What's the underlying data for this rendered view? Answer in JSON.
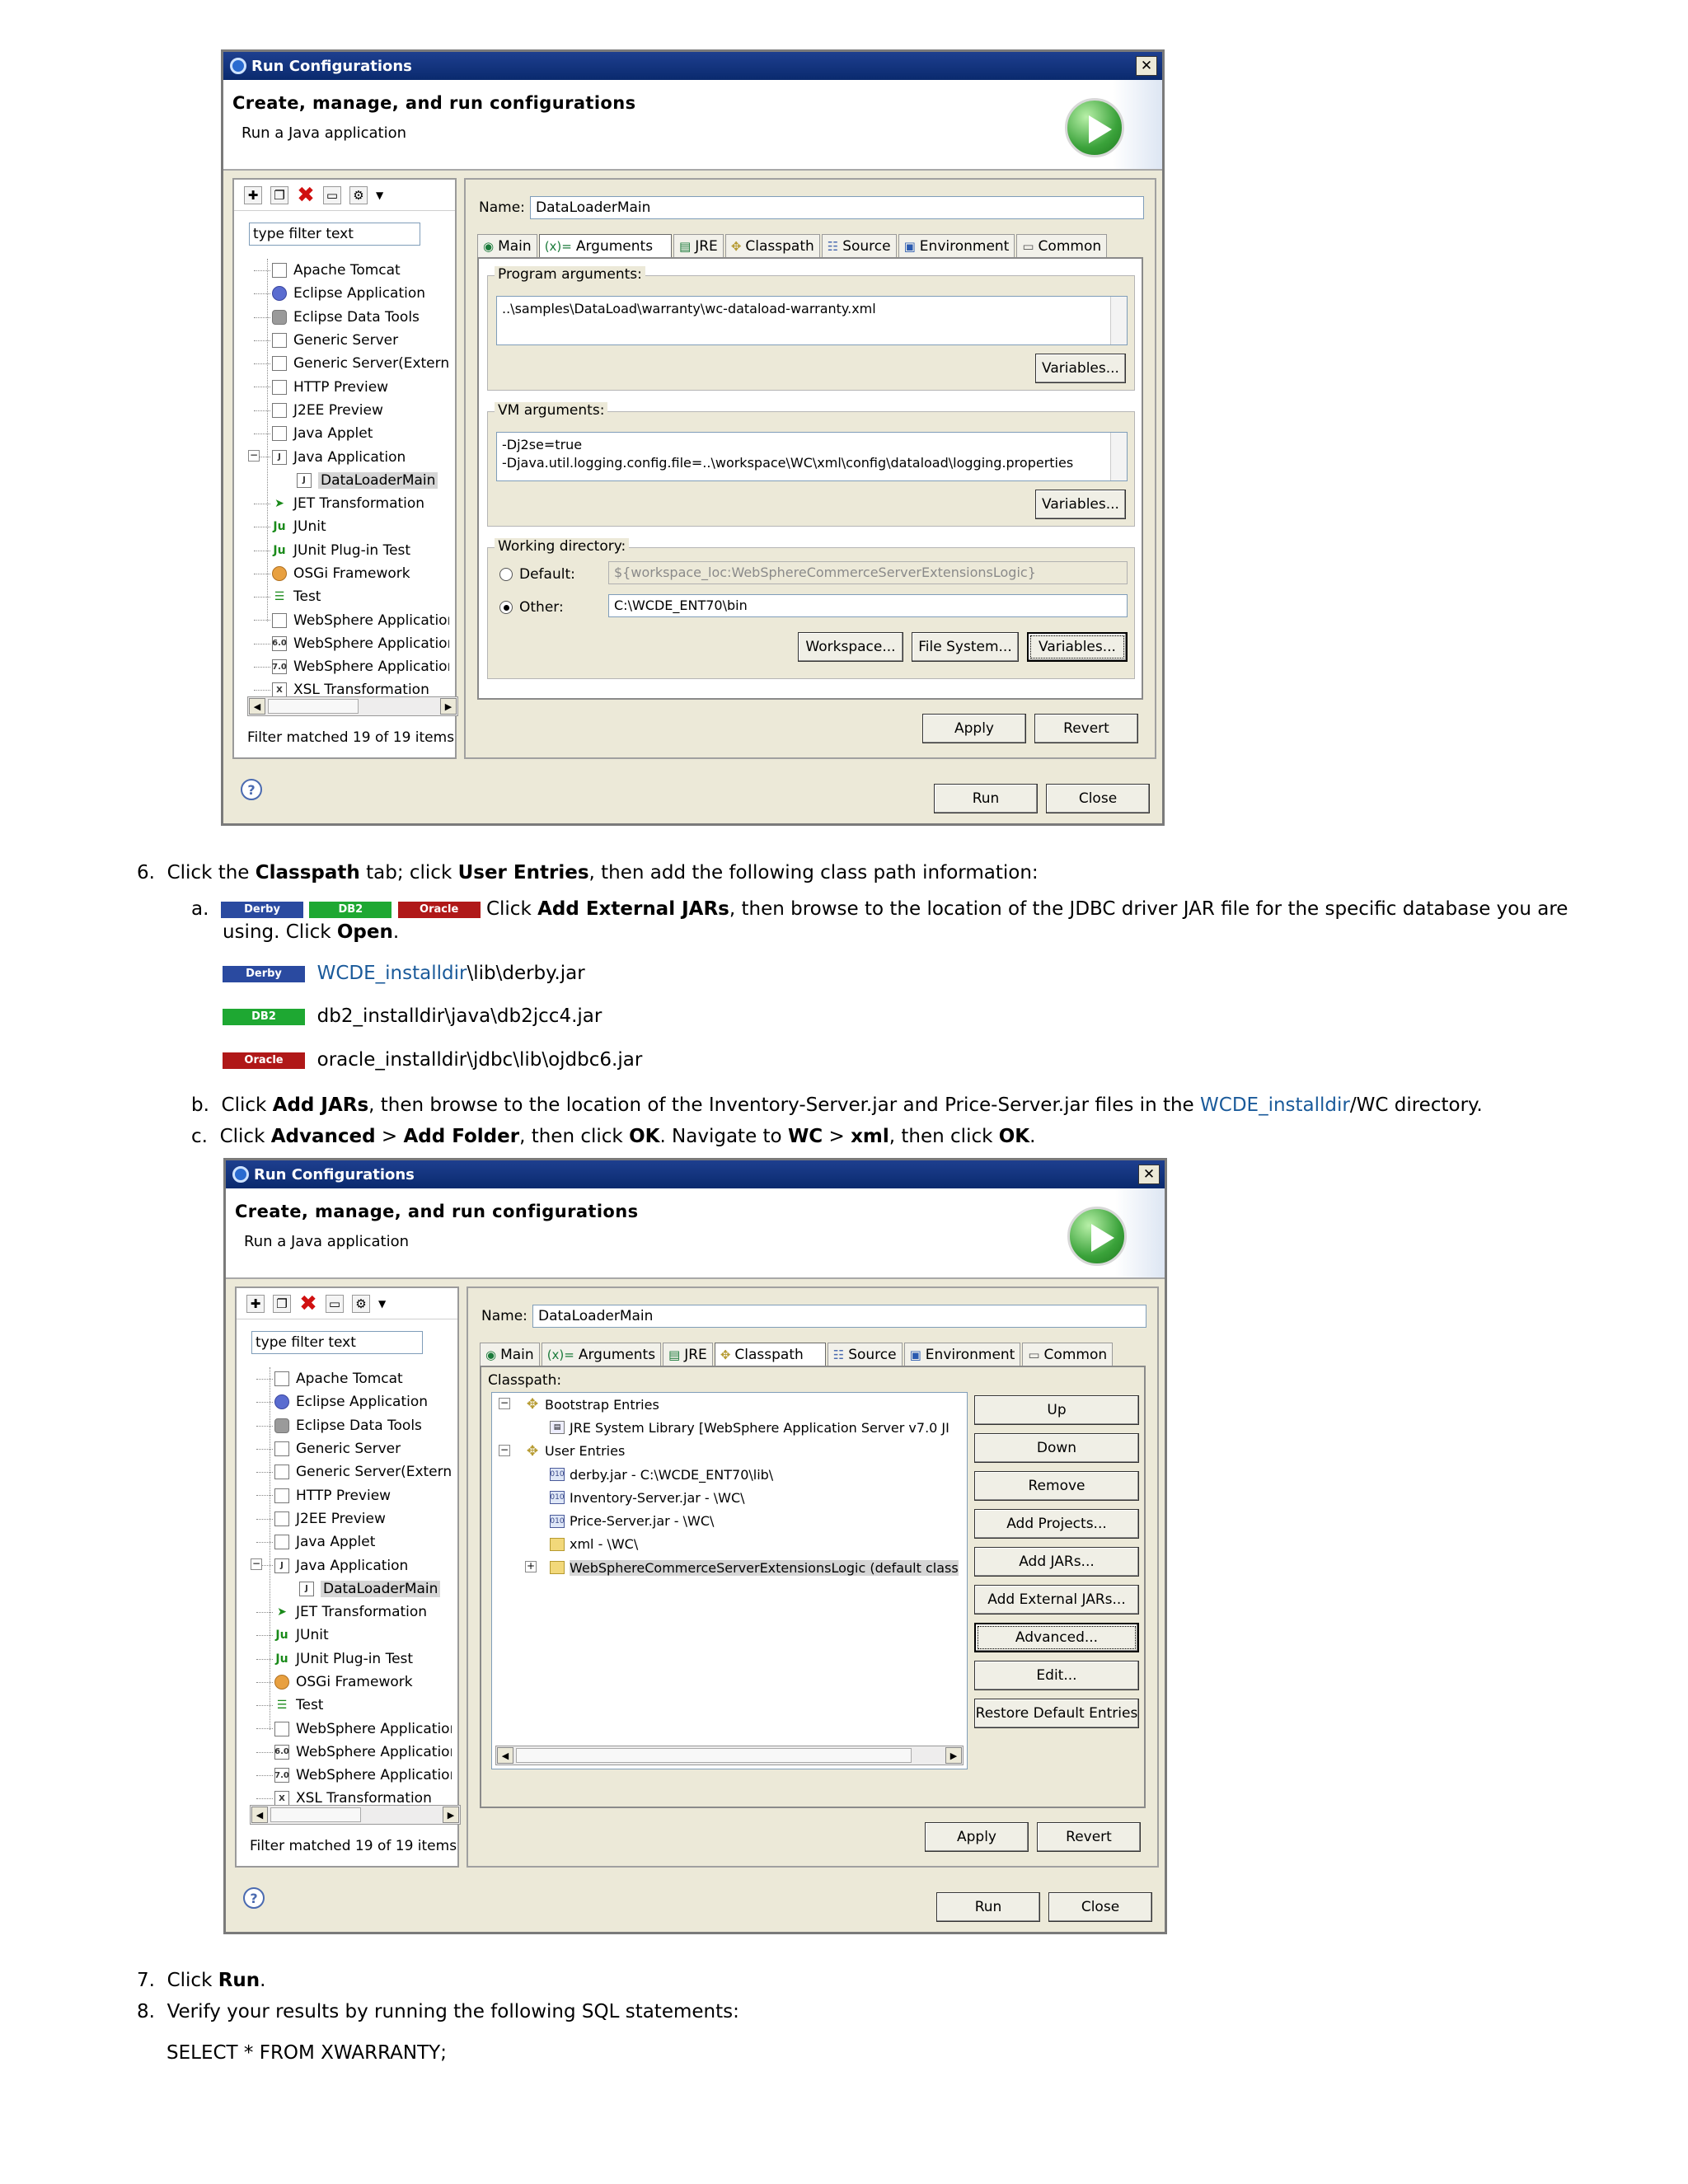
{
  "window1": {
    "title": "Run Configurations",
    "close_glyph": "✕",
    "banner_heading": "Create, manage, and run configurations",
    "banner_sub": "Run a Java application",
    "filter_text": "type filter text",
    "tree": [
      "Apache Tomcat",
      "Eclipse Application",
      "Eclipse Data Tools",
      "Generic Server",
      "Generic Server(Externa",
      "HTTP Preview",
      "J2EE Preview",
      "Java Applet",
      "Java Application",
      "DataLoaderMain",
      "JET Transformation",
      "JUnit",
      "JUnit Plug-in Test",
      "OSGi Framework",
      "Test",
      "WebSphere Application",
      "WebSphere Application",
      "WebSphere Application",
      "XSL Transformation"
    ],
    "filter_status": "Filter matched 19 of 19 items",
    "name_label": "Name:",
    "name_value": "DataLoaderMain",
    "tabs": [
      "Main",
      "Arguments",
      "JRE",
      "Classpath",
      "Source",
      "Environment",
      "Common"
    ],
    "program_args_label": "Program arguments:",
    "program_args": "..\\samples\\DataLoad\\warranty\\wc-dataload-warranty.xml",
    "vm_args_label": "VM arguments:",
    "vm_args": "-Dj2se=true\n-Djava.util.logging.config.file=..\\workspace\\WC\\xml\\config\\dataload\\logging.properties",
    "variables_label": "Variables...",
    "working_dir_label": "Working directory:",
    "default_label": "Default:",
    "default_value": "${workspace_loc:WebSphereCommerceServerExtensionsLogic}",
    "other_label": "Other:",
    "other_value": "C:\\WCDE_ENT70\\bin",
    "workspace_btn": "Workspace...",
    "filesystem_btn": "File System...",
    "apply": "Apply",
    "revert": "Revert",
    "run": "Run",
    "close": "Close",
    "help_glyph": "?"
  },
  "window2": {
    "title": "Run Configurations",
    "banner_heading": "Create, manage, and run configurations",
    "banner_sub": "Run a Java application",
    "classpath_label": "Classpath:",
    "classpath_items": [
      "Bootstrap Entries",
      "JRE System Library [WebSphere Application Server v7.0 JI",
      "User Entries",
      "derby.jar - C:\\WCDE_ENT70\\lib\\",
      "Inventory-Server.jar - \\WC\\",
      "Price-Server.jar - \\WC\\",
      "xml - \\WC\\",
      "WebSphereCommerceServerExtensionsLogic (default class"
    ],
    "buttons": [
      "Up",
      "Down",
      "Remove",
      "Add Projects...",
      "Add JARs...",
      "Add External JARs...",
      "Advanced...",
      "Edit...",
      "Restore Default Entries"
    ]
  },
  "doc": {
    "step6_num": "6.",
    "step6_a": "Click the ",
    "step6_b": "Classpath",
    "step6_c": " tab; click ",
    "step6_d": "User Entries",
    "step6_e": ", then add the following class path information:",
    "a_num": "a.",
    "badge_derby": "Derby",
    "badge_db2": "DB2",
    "badge_oracle": "Oracle",
    "a_text1": " Click ",
    "a_text2": "Add External JARs",
    "a_text3": ", then browse to the location of the JDBC driver JAR file for the specific database you are",
    "a_text4": "using. Click ",
    "a_text5": "Open",
    "a_text6": ".",
    "derby_link": "WCDE_installdir",
    "derby_path": "\\lib\\derby.jar",
    "db2_path": "db2_installdir\\java\\db2jcc4.jar",
    "oracle_path": "oracle_installdir\\jdbc\\lib\\ojdbc6.jar",
    "b_num": "b.",
    "b_text1": "Click ",
    "b_text2": "Add JARs",
    "b_text3": ", then browse to the location of the Inventory-Server.jar and Price-Server.jar files in the ",
    "b_link": "WCDE_installdir",
    "b_text4": "/WC directory.",
    "c_num": "c.",
    "c_text1": "Click ",
    "c_text2": "Advanced",
    "c_text3": " > ",
    "c_text4": "Add Folder",
    "c_text5": ", then click ",
    "c_text6": "OK",
    "c_text7": ". Navigate to ",
    "c_text8": "WC",
    "c_text9": " > ",
    "c_text10": "xml",
    "c_text11": ", then click ",
    "c_text12": "OK",
    "c_text13": ".",
    "step7_num": "7.",
    "step7_a": "Click ",
    "step7_b": "Run",
    "step7_c": ".",
    "step8_num": "8.",
    "step8": "Verify your results by running the following SQL statements:",
    "sql": "SELECT * FROM XWARRANTY;"
  }
}
